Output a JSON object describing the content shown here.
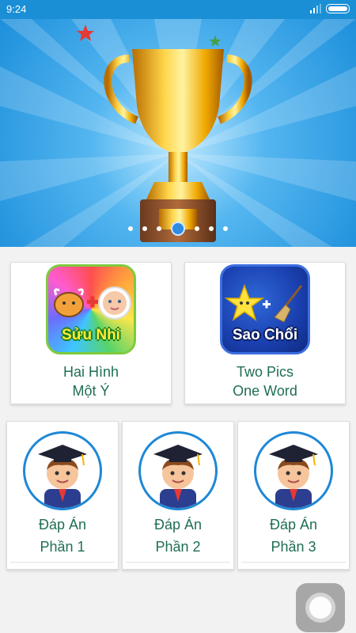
{
  "status_bar": {
    "time": "9:24"
  },
  "banner": {
    "slides": 7,
    "active_slide": 4
  },
  "games": [
    {
      "label_line1": "Hai Hình",
      "label_line2": "Một Ý",
      "icon_text": "Sửu Nhi",
      "icon": "ox-plus-baby-icon"
    },
    {
      "label_line1": "Two Pics",
      "label_line2": "One Word",
      "icon_text": "Sao Chổi",
      "icon": "star-plus-broom-icon"
    }
  ],
  "answers": [
    {
      "line1": "Đáp Án",
      "line2": "Phần 1"
    },
    {
      "line1": "Đáp Án",
      "line2": "Phần 2"
    },
    {
      "line1": "Đáp Án",
      "line2": "Phần 3"
    }
  ],
  "colors": {
    "status_bar": "#1a8fd6",
    "label_green": "#1f6e52",
    "avatar_ring": "#1e88d6"
  }
}
